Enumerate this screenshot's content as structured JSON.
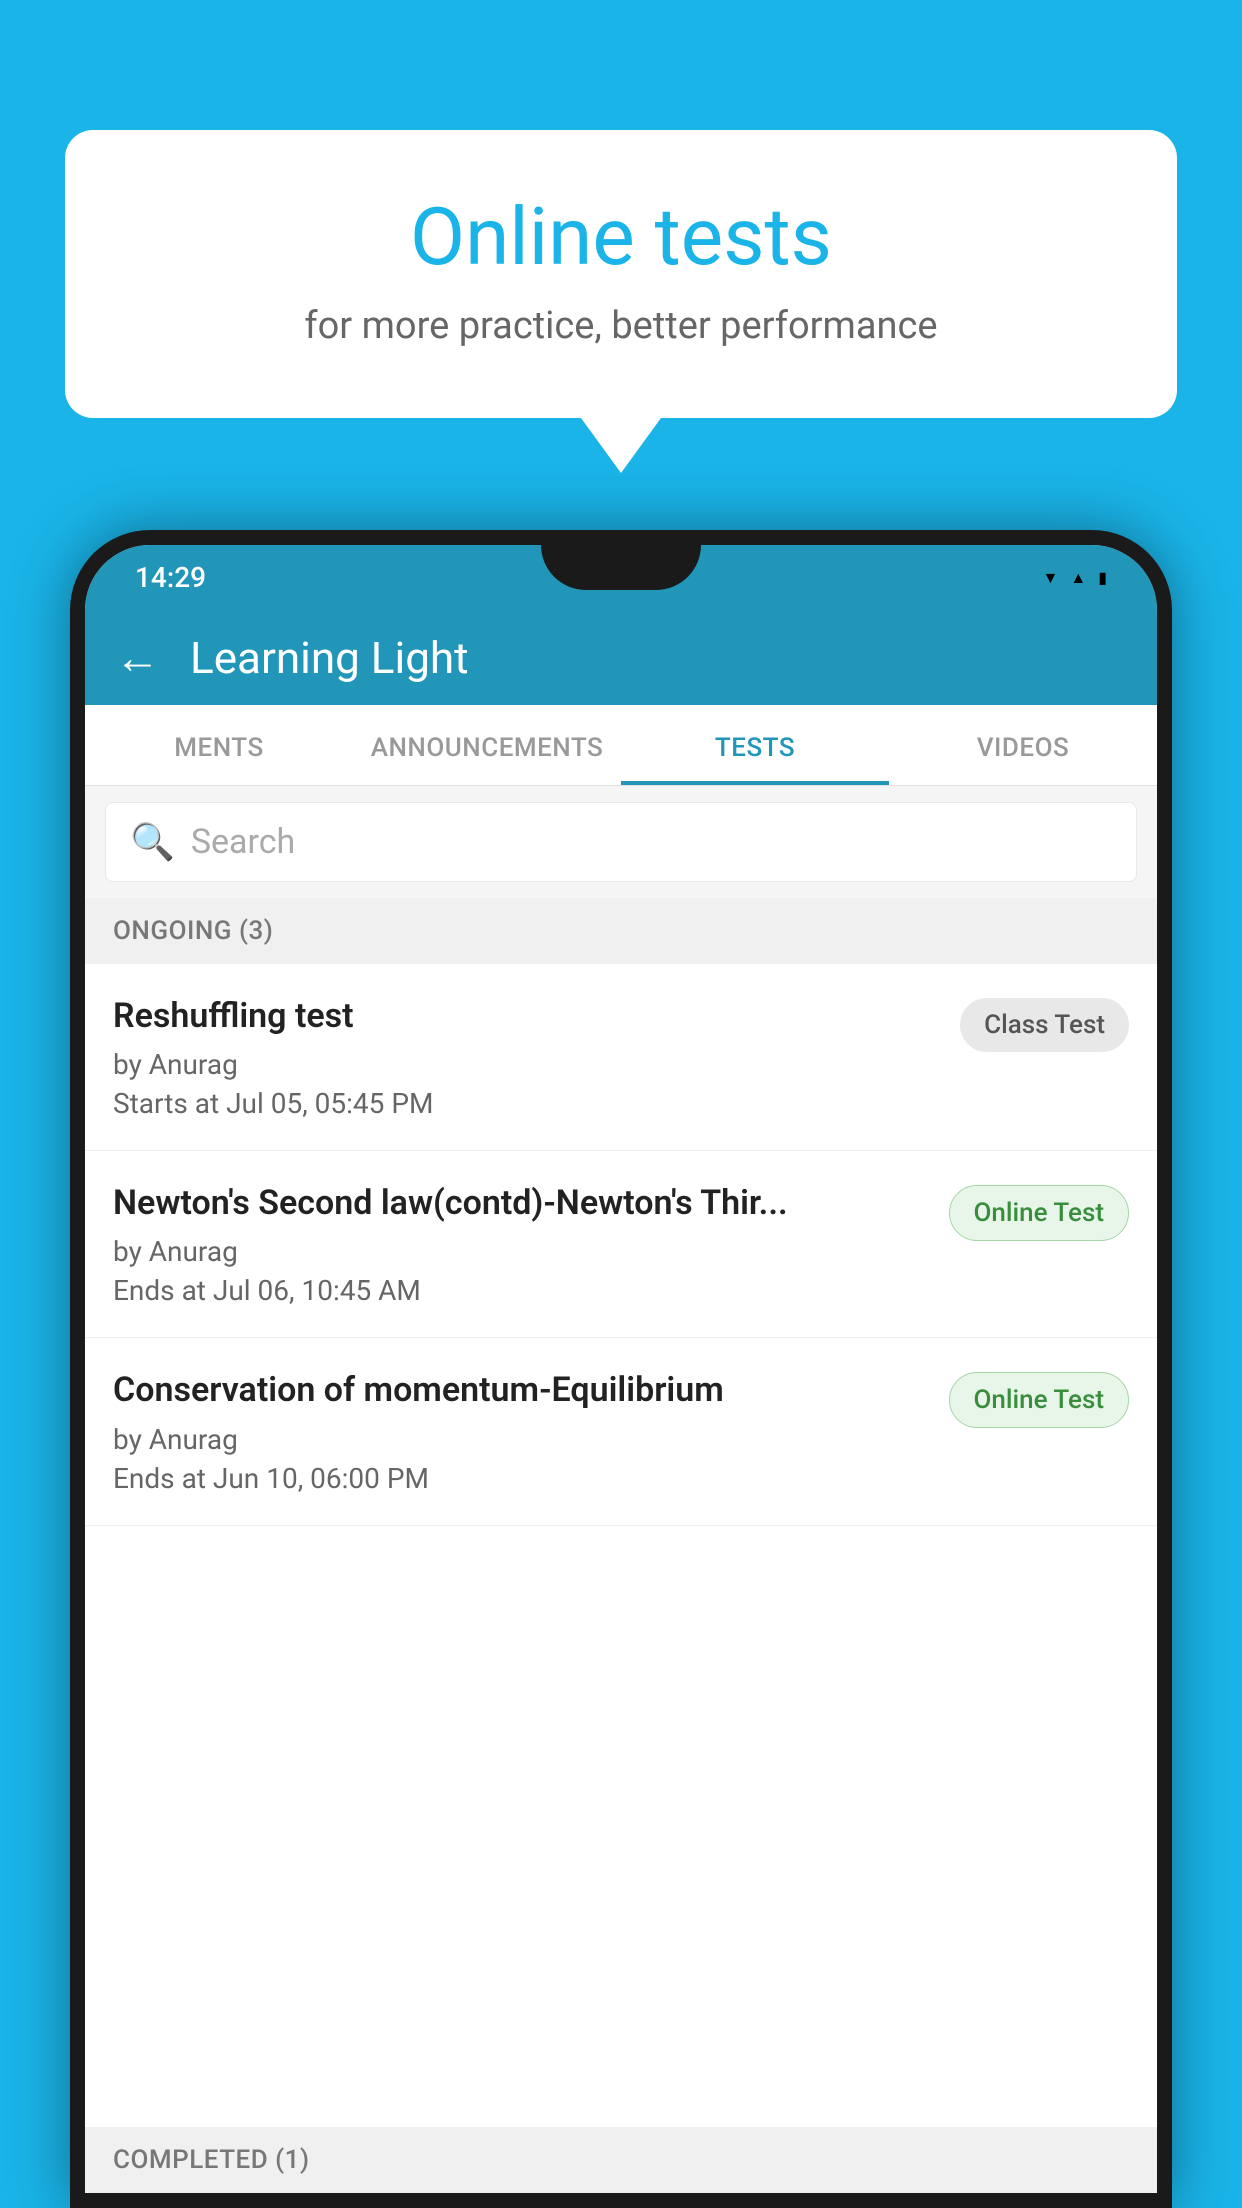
{
  "background": {
    "color": "#1ab4e8"
  },
  "speech_bubble": {
    "title": "Online tests",
    "subtitle": "for more practice, better performance"
  },
  "phone": {
    "status_bar": {
      "time": "14:29",
      "icons": [
        "wifi",
        "signal",
        "battery"
      ]
    },
    "app_header": {
      "title": "Learning Light",
      "back_label": "←"
    },
    "tabs": [
      {
        "label": "MENTS",
        "active": false
      },
      {
        "label": "ANNOUNCEMENTS",
        "active": false
      },
      {
        "label": "TESTS",
        "active": true
      },
      {
        "label": "VIDEOS",
        "active": false
      }
    ],
    "search": {
      "placeholder": "Search"
    },
    "sections": [
      {
        "header": "ONGOING (3)",
        "items": [
          {
            "name": "Reshuffling test",
            "by": "by Anurag",
            "time_label": "Starts at",
            "time": "Jul 05, 05:45 PM",
            "badge": "Class Test",
            "badge_type": "class"
          },
          {
            "name": "Newton's Second law(contd)-Newton's Thir...",
            "by": "by Anurag",
            "time_label": "Ends at",
            "time": "Jul 06, 10:45 AM",
            "badge": "Online Test",
            "badge_type": "online"
          },
          {
            "name": "Conservation of momentum-Equilibrium",
            "by": "by Anurag",
            "time_label": "Ends at",
            "time": "Jun 10, 06:00 PM",
            "badge": "Online Test",
            "badge_type": "online"
          }
        ]
      }
    ],
    "completed_section": {
      "header": "COMPLETED (1)"
    }
  }
}
